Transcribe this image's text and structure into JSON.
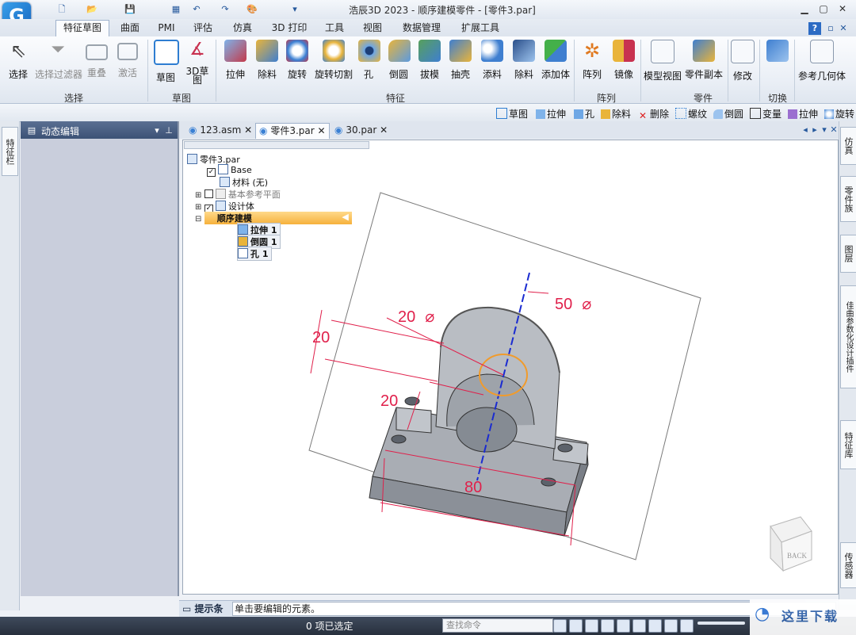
{
  "window": {
    "title": "浩辰3D 2023 - 顺序建模零件 - [零件3.par]",
    "logo_letter": "G",
    "quick_access_icons": [
      "new-file-icon",
      "save-icon",
      "undo-icon",
      "redo-icon",
      "grid-icon"
    ]
  },
  "ribbon_tabs": [
    "特征草图",
    "曲面",
    "PMI",
    "评估",
    "仿真",
    "3D 打印",
    "工具",
    "视图",
    "数据管理",
    "扩展工具"
  ],
  "ribbon": {
    "buttons": [
      "选择",
      "选择过滤器",
      "重叠",
      "激活",
      "草图",
      "3D草图",
      "拉伸",
      "除料",
      "旋转",
      "旋转切割",
      "孔",
      "倒圆",
      "拔模",
      "抽壳",
      "添料",
      "除料",
      "添加体",
      "阵列",
      "镜像",
      "模型视图",
      "零件副本",
      "修改",
      "切换",
      "参考几何体"
    ],
    "groups": [
      "选择",
      "草图",
      "特征",
      "阵列",
      "零件",
      "切换"
    ]
  },
  "command_bar": [
    "草图",
    "拉伸",
    "孔",
    "除料",
    "删除",
    "螺纹",
    "倒圆",
    "变量",
    "拉伸",
    "旋转"
  ],
  "left_strip_tab": "特征栏",
  "panel": {
    "title": "动态编辑"
  },
  "doc_tabs": [
    "123.asm",
    "零件3.par",
    "30.par"
  ],
  "tree": {
    "root": "零件3.par",
    "items": [
      "Base",
      "材料 (无)",
      "基本参考平面",
      "设计体",
      "顺序建模",
      "拉伸 1",
      "倒圆 1",
      "孔 1"
    ]
  },
  "dimensions": {
    "d50": "50",
    "d20a": "20",
    "d20b": "20",
    "d20c": "20",
    "d80": "80",
    "diam": "⌀"
  },
  "view_cube_label": "BACK",
  "right_tabs": [
    "仿真",
    "零件族",
    "图层",
    "佳曲参数化设计插件",
    "特征库",
    "传感器"
  ],
  "prompt": {
    "label": "提示条",
    "text": "单击要编辑的元素。"
  },
  "status": {
    "selection": "0 项已选定",
    "command_placeholder": "查找命令"
  },
  "watermark": "这里下载"
}
